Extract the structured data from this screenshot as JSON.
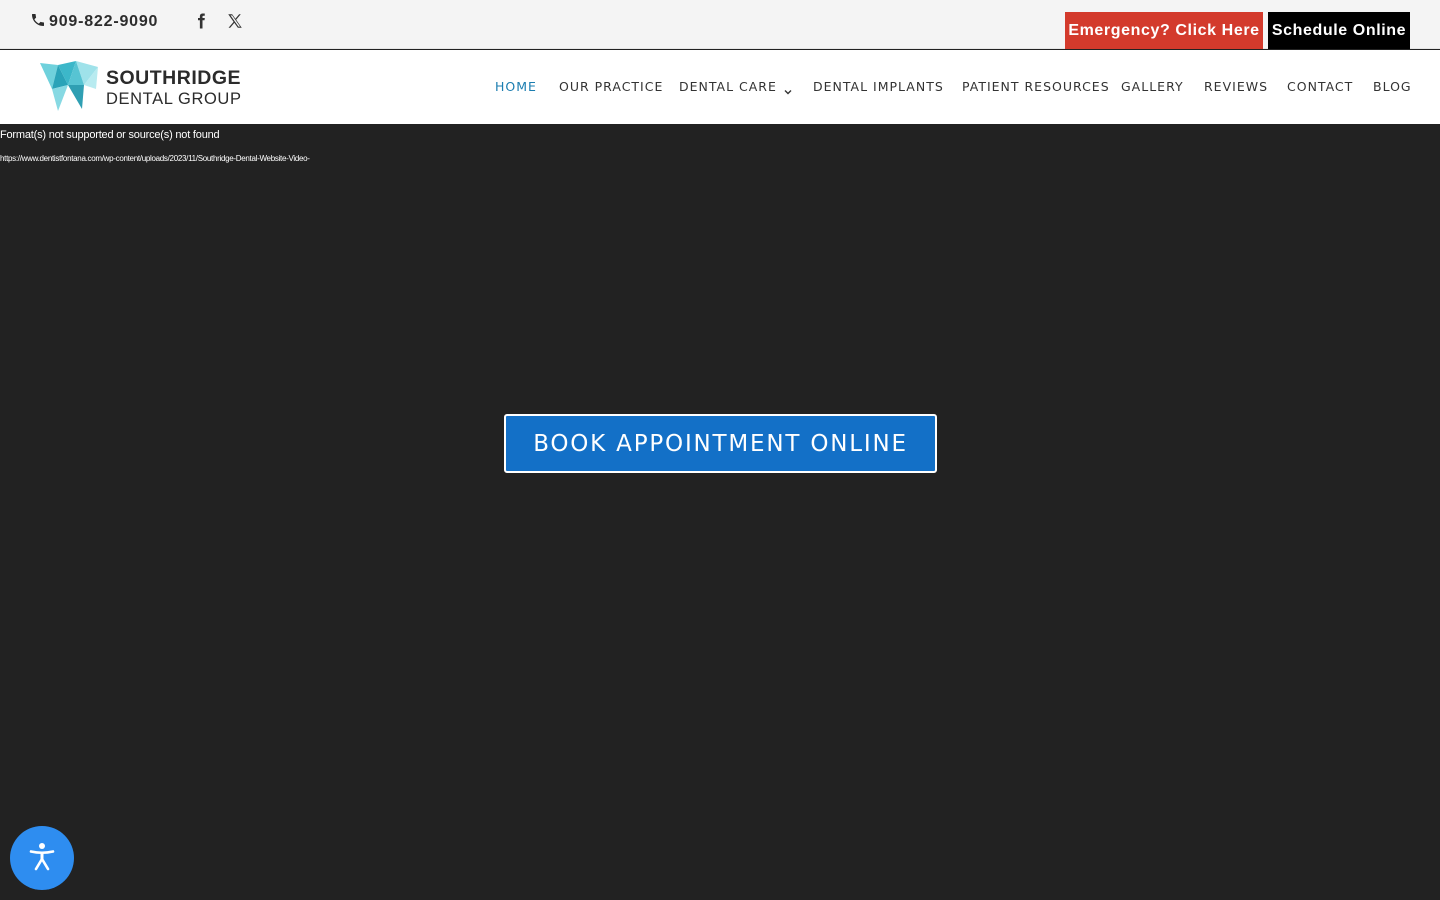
{
  "topbar": {
    "phone": "909-822-9090",
    "phone_icon": "phone-icon",
    "social": [
      {
        "name": "facebook-icon"
      },
      {
        "name": "x-twitter-icon"
      }
    ],
    "emergency_label": "Emergency? Click Here",
    "schedule_label": "Schedule Online",
    "emergency_color": "#d33a2c",
    "schedule_color": "#000000"
  },
  "header": {
    "logo_line1": "SOUTHRIDGE",
    "logo_line2": "DENTAL GROUP",
    "logo_icon": "tooth-logo-icon",
    "nav": [
      {
        "label": "HOME",
        "active": true
      },
      {
        "label": "OUR PRACTICE"
      },
      {
        "label": "DENTAL CARE",
        "has_dropdown": true
      },
      {
        "label": "DENTAL IMPLANTS"
      },
      {
        "label": "PATIENT RESOURCES"
      },
      {
        "label": "GALLERY"
      },
      {
        "label": "REVIEWS"
      },
      {
        "label": "CONTACT"
      },
      {
        "label": "BLOG"
      }
    ],
    "active_color": "#1b7db0"
  },
  "hero": {
    "error_message": "Format(s) not supported or source(s) not found",
    "video_url": "https://www.dentistfontana.com/wp-content/uploads/2023/11/Southridge-Dental-Website-Video-",
    "book_label": "BOOK APPOINTMENT ONLINE",
    "book_color": "#1370c7",
    "background_color": "#222222"
  },
  "accessibility": {
    "icon": "accessibility-icon",
    "color": "#2e8df0"
  }
}
